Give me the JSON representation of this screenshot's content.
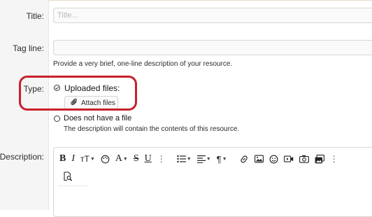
{
  "fields": {
    "title": {
      "label": "Title:",
      "placeholder": "Title...",
      "value": ""
    },
    "tagline": {
      "label": "Tag line:",
      "value": "",
      "hint": "Provide a very brief, one-line description of your resource."
    },
    "type": {
      "label": "Type:",
      "options": [
        {
          "label": "Uploaded files:",
          "selected": true
        },
        {
          "label": "Does not have a file",
          "selected": false,
          "hint": "The description will contain the contents of this resource."
        }
      ],
      "attach_label": "Attach files"
    },
    "description": {
      "label": "Description:"
    }
  },
  "toolbar": {
    "bold": "B",
    "italic": "I",
    "text_size": "тT",
    "font_family": "A",
    "strike": "S",
    "underline": "U",
    "more": "⋮",
    "paragraph": "¶"
  },
  "colors": {
    "highlight": "#c8202a",
    "label_bg": "#f5f5f5"
  }
}
